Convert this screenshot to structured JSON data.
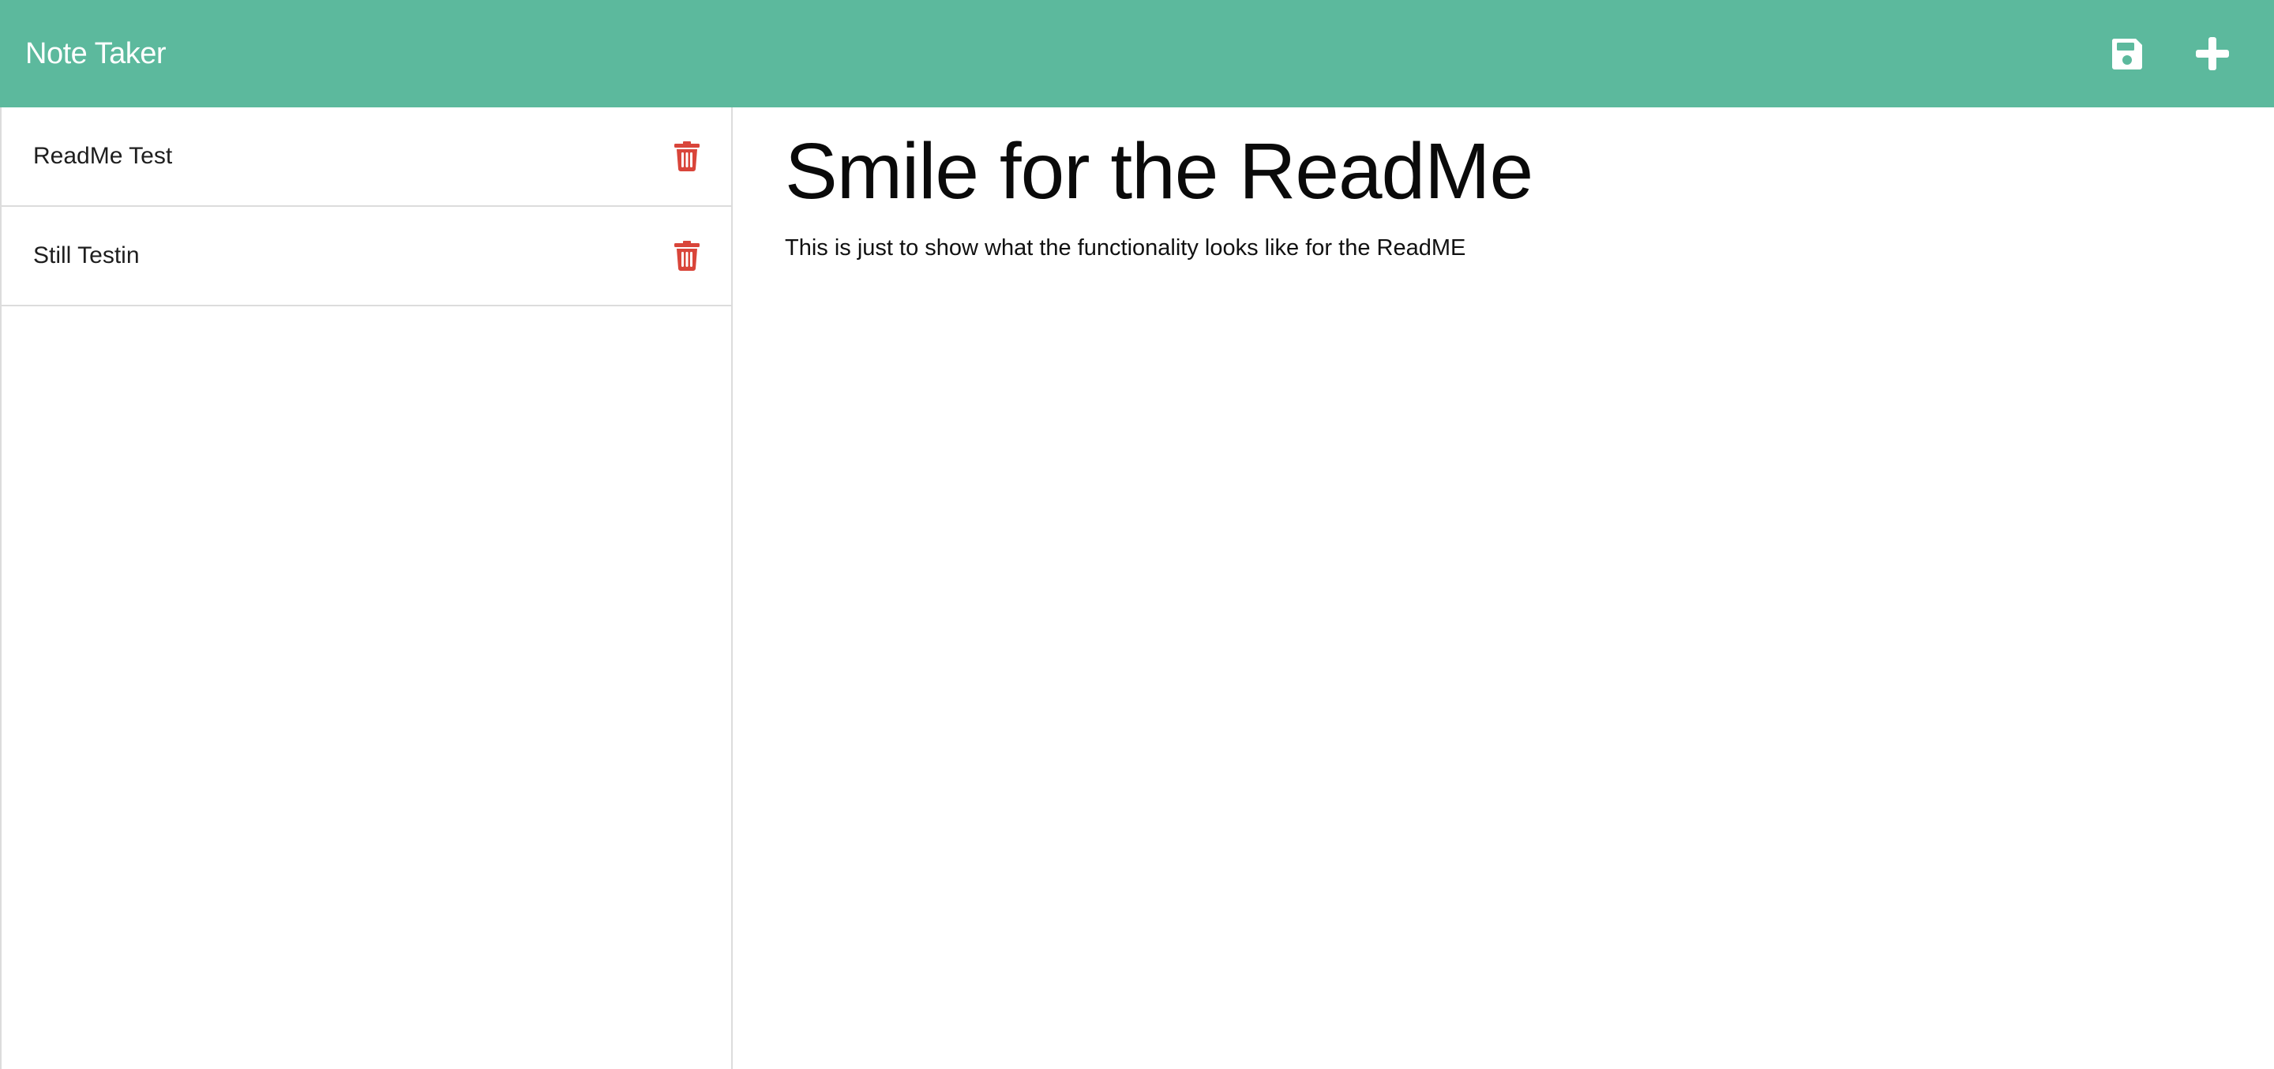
{
  "app": {
    "title": "Note Taker"
  },
  "toolbar": {
    "save_icon": "floppy-disk-icon",
    "add_icon": "plus-icon"
  },
  "notes": [
    {
      "title": "ReadMe Test",
      "delete_icon": "trash-icon"
    },
    {
      "title": "Still Testin",
      "delete_icon": "trash-icon"
    }
  ],
  "active_note": {
    "title": "Smile for the ReadMe",
    "text": "This is just to show what the functionality looks like for the ReadME"
  },
  "colors": {
    "navbar": "#5cb99d",
    "delete": "#d9453a",
    "icon": "#ffffff"
  }
}
